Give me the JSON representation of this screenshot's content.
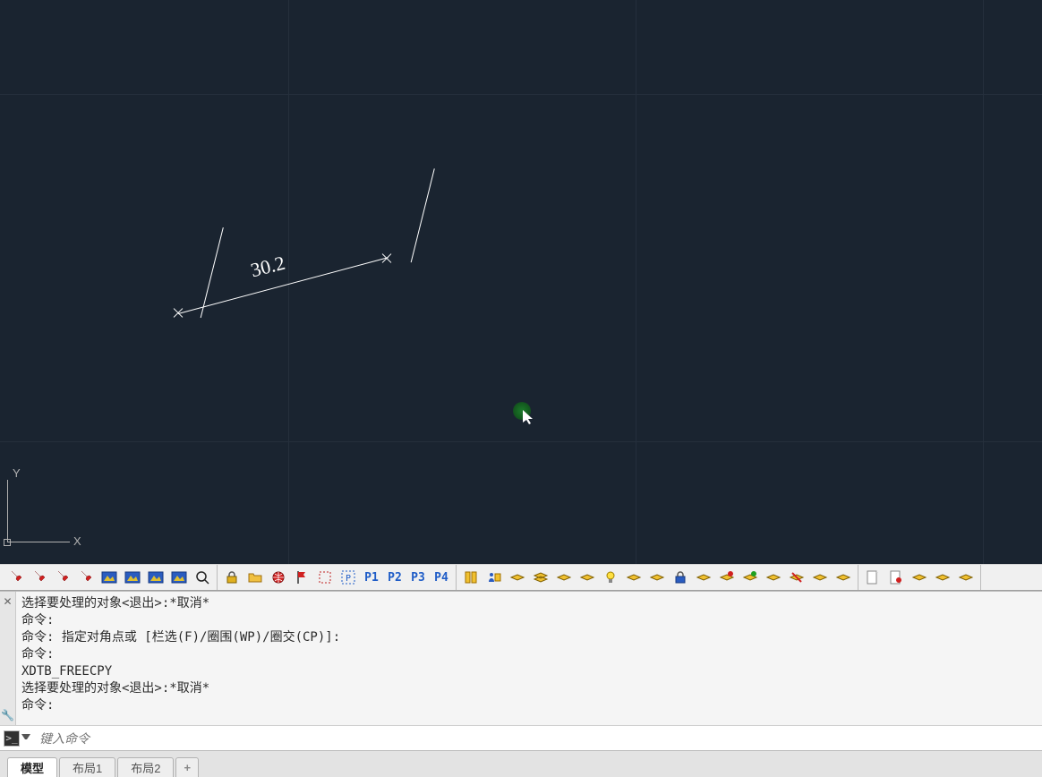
{
  "canvas": {
    "dimension_value": "30.2",
    "axes": {
      "x_label": "X",
      "y_label": "Y"
    }
  },
  "toolbar_text_buttons": {
    "p1": "P1",
    "p2": "P2",
    "p3": "P3",
    "p4": "P4"
  },
  "icons": {
    "group1": [
      "pin-a",
      "pin-b",
      "pin-c",
      "pin-d",
      "picture-a",
      "picture-b",
      "picture-c",
      "picture-d",
      "zoom-circle"
    ],
    "group2": [
      "lock",
      "folder-open",
      "globe-red",
      "flag-red",
      "selection-box",
      "selection-p"
    ],
    "group3": [
      "book-yellow",
      "person-book"
    ],
    "layer_group": [
      "layer-a",
      "layer-b",
      "layer-c",
      "layer-d",
      "bulb",
      "layer-e",
      "layer-f",
      "lock-blue",
      "layer-g",
      "layer-h",
      "layer-i",
      "layer-j",
      "layer-x",
      "layer-y",
      "layer-z"
    ],
    "group5": [
      "page-a",
      "page-b",
      "layer-m",
      "layer-n",
      "layer-o"
    ]
  },
  "command_log": [
    "选择要处理的对象<退出>:*取消*",
    "命令:",
    "命令: 指定对角点或 [栏选(F)/圈围(WP)/圈交(CP)]:",
    "命令:",
    "XDTB_FREECPY",
    "选择要处理的对象<退出>:*取消*",
    "命令:"
  ],
  "command_input": {
    "placeholder": "键入命令"
  },
  "tabs": [
    {
      "label": "模型",
      "active": true
    },
    {
      "label": "布局1",
      "active": false
    },
    {
      "label": "布局2",
      "active": false
    }
  ],
  "tab_add_label": "+"
}
